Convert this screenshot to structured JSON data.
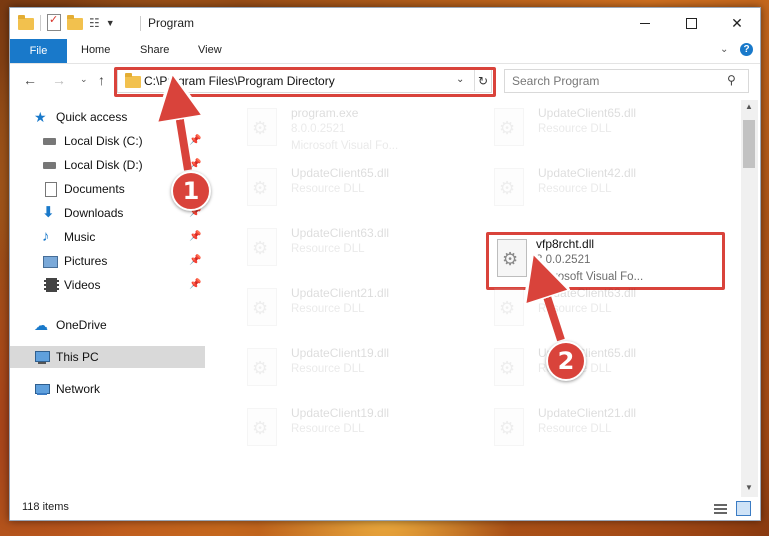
{
  "window": {
    "title": "Program"
  },
  "ribbon": {
    "file": "File",
    "tabs": [
      "Home",
      "Share",
      "View"
    ]
  },
  "address": {
    "path": "C:\\Program Files\\Program Directory"
  },
  "search": {
    "placeholder": "Search Program"
  },
  "sidebar": {
    "quick_access": "Quick access",
    "items": [
      {
        "label": "Local Disk (C:)",
        "pinned": true
      },
      {
        "label": "Local Disk (D:)",
        "pinned": true
      },
      {
        "label": "Documents",
        "pinned": true
      },
      {
        "label": "Downloads",
        "pinned": true
      },
      {
        "label": "Music",
        "pinned": true
      },
      {
        "label": "Pictures",
        "pinned": true
      },
      {
        "label": "Videos",
        "pinned": true
      }
    ],
    "onedrive": "OneDrive",
    "thispc": "This PC",
    "network": "Network"
  },
  "files": [
    {
      "name": "program.exe",
      "meta1": "8.0.0.2521",
      "meta2": "Microsoft Visual Fo...",
      "faded": true
    },
    {
      "name": "UpdateClient65.dll",
      "meta1": "Resource DLL",
      "meta2": "",
      "faded": true
    },
    {
      "name": "UpdateClient65.dll",
      "meta1": "Resource DLL",
      "meta2": "",
      "faded": true
    },
    {
      "name": "UpdateClient42.dll",
      "meta1": "Resource DLL",
      "meta2": "",
      "faded": true
    },
    {
      "name": "UpdateClient63.dll",
      "meta1": "Resource DLL",
      "meta2": "",
      "faded": true
    },
    {
      "name": "vfp8rcht.dll",
      "meta1": "8.0.0.2521",
      "meta2": "Microsoft Visual Fo...",
      "faded": false
    },
    {
      "name": "UpdateClient21.dll",
      "meta1": "Resource DLL",
      "meta2": "",
      "faded": true
    },
    {
      "name": "UpdateClient63.dll",
      "meta1": "Resource DLL",
      "meta2": "",
      "faded": true
    },
    {
      "name": "UpdateClient19.dll",
      "meta1": "Resource DLL",
      "meta2": "",
      "faded": true
    },
    {
      "name": "UpdateClient65.dll",
      "meta1": "Resource DLL",
      "meta2": "",
      "faded": true
    },
    {
      "name": "UpdateClient19.dll",
      "meta1": "Resource DLL",
      "meta2": "",
      "faded": true
    },
    {
      "name": "UpdateClient21.dll",
      "meta1": "Resource DLL",
      "meta2": "",
      "faded": true
    }
  ],
  "status": {
    "items": "118 items"
  },
  "annotations": {
    "badge1": "1",
    "badge2": "2"
  },
  "colors": {
    "accent": "#1979ca",
    "highlight": "#d9433b"
  }
}
